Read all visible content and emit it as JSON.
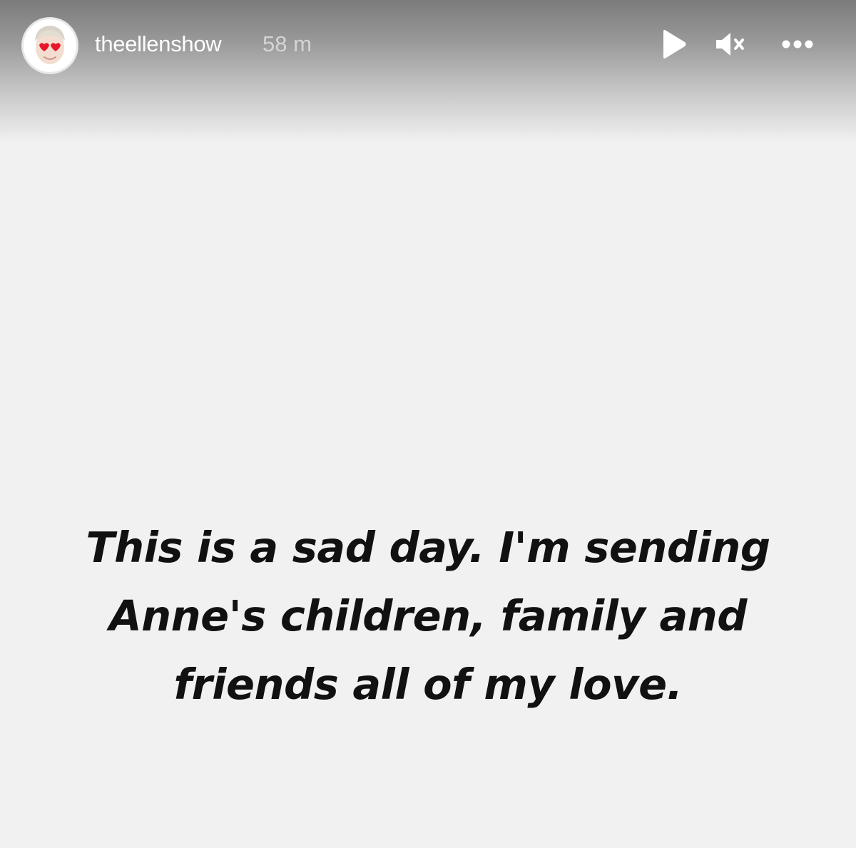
{
  "story": {
    "username": "theellenshow",
    "timestamp": "58 m",
    "message": "This is a sad day. I'm sending Anne's children, family and friends all of my love."
  },
  "controls": {
    "play_icon": "play-icon",
    "mute_icon": "muted-speaker-icon",
    "more_icon": "more-options-icon"
  },
  "colors": {
    "background": "#f1f1f1",
    "text": "#111111",
    "header_text": "#ffffff",
    "avatar_glasses": "#e8162a"
  }
}
